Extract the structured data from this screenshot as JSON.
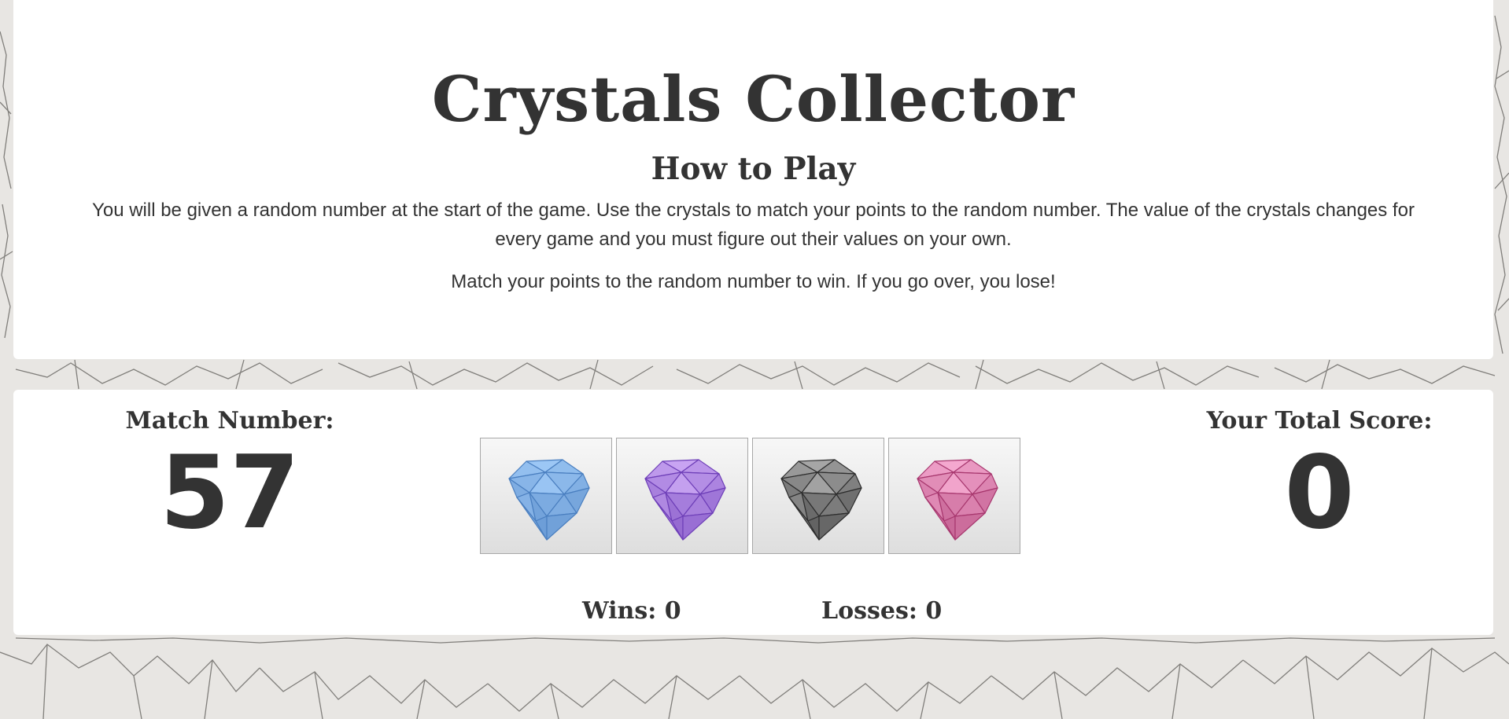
{
  "header": {
    "title": "Crystals Collector",
    "subtitle": "How to Play",
    "instructions": "You will be given a random number at the start of the game. Use the crystals to match your points to the random number. The value of the crystals changes for every game and you must figure out their values on your own.",
    "instructions_win": "Match your points to the random number to win. If you go over, you lose!"
  },
  "game": {
    "match_label": "Match Number:",
    "match_number": "57",
    "score_label": "Your Total Score:",
    "total_score": "0",
    "wins_label": "Wins: 0",
    "losses_label": "Losses: 0",
    "crystals": [
      {
        "name": "blue-crystal-icon",
        "color": "#9cc7f5",
        "dark": "#4a7fc0"
      },
      {
        "name": "purple-crystal-icon",
        "color": "#c8a4f2",
        "dark": "#6e3fb8"
      },
      {
        "name": "gray-crystal-icon",
        "color": "#a6a6a6",
        "dark": "#2e2e2e"
      },
      {
        "name": "pink-crystal-icon",
        "color": "#f4a8cf",
        "dark": "#a8386f"
      }
    ]
  }
}
